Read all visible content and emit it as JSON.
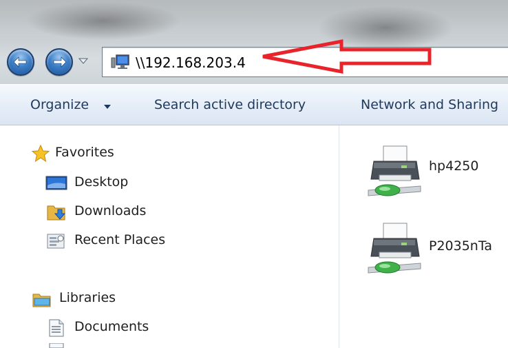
{
  "address_bar": {
    "path": "\\\\192.168.203.4"
  },
  "toolbar": {
    "organize_label": "Organize",
    "search_ad_label": "Search active directory",
    "network_label": "Network and Sharing"
  },
  "nav_pane": {
    "favorites": {
      "label": "Favorites",
      "items": [
        {
          "label": "Desktop",
          "icon": "desktop-icon"
        },
        {
          "label": "Downloads",
          "icon": "downloads-icon"
        },
        {
          "label": "Recent Places",
          "icon": "recent-places-icon"
        }
      ]
    },
    "libraries": {
      "label": "Libraries",
      "items": [
        {
          "label": "Documents",
          "icon": "documents-icon"
        }
      ]
    }
  },
  "content": {
    "printers": [
      {
        "name": "hp4250",
        "icon": "network-printer-icon"
      },
      {
        "name": "P2035nTa",
        "icon": "network-printer-icon"
      }
    ]
  },
  "annotation": {
    "color": "#e8232a"
  }
}
